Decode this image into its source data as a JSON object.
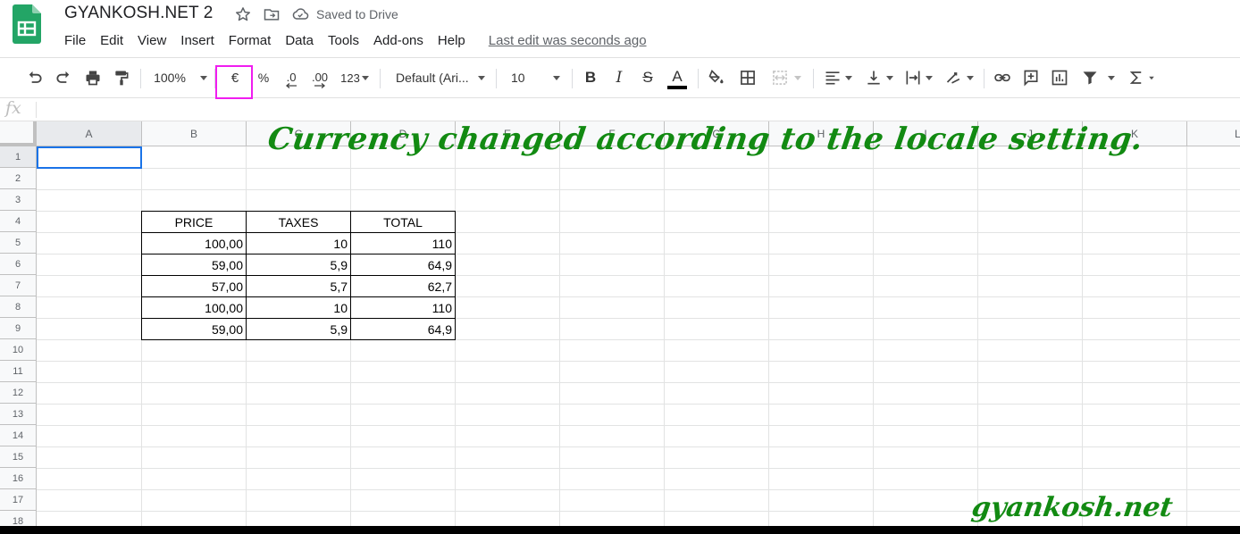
{
  "header": {
    "doc_title": "GYANKOSH.NET 2",
    "saved_status": "Saved to Drive",
    "menu": [
      "File",
      "Edit",
      "View",
      "Insert",
      "Format",
      "Data",
      "Tools",
      "Add-ons",
      "Help"
    ],
    "last_edit": "Last edit was seconds ago"
  },
  "toolbar": {
    "zoom": "100%",
    "currency_symbol": "€",
    "percent": "%",
    "decrease_decimal": ".0",
    "increase_decimal": ".00",
    "more_formats": "123",
    "font": "Default (Ari...",
    "font_size": "10",
    "bold": "B",
    "italic": "I",
    "strikethrough": "S",
    "text_color_letter": "A",
    "highlight_color": "#f01df0"
  },
  "formula_bar": {
    "fx_label": "fx"
  },
  "sheet": {
    "columns": [
      "A",
      "B",
      "C",
      "D",
      "E",
      "F",
      "G",
      "H",
      "I",
      "J",
      "K",
      "L"
    ],
    "rows": [
      "1",
      "2",
      "3",
      "4",
      "5",
      "6",
      "7",
      "8",
      "9",
      "10",
      "11",
      "12",
      "13",
      "14",
      "15",
      "16",
      "17",
      "18"
    ],
    "selected_cell": "A1",
    "table": {
      "headers": [
        "PRICE",
        "TAXES",
        "TOTAL"
      ],
      "rows": [
        [
          "100,00",
          "10",
          "110"
        ],
        [
          "59,00",
          "5,9",
          "64,9"
        ],
        [
          "57,00",
          "5,7",
          "62,7"
        ],
        [
          "100,00",
          "10",
          "110"
        ],
        [
          "59,00",
          "5,9",
          "64,9"
        ]
      ]
    }
  },
  "annotation": "Currency changed according to the locale setting.",
  "watermark": "gyankosh.net",
  "colors": {
    "annotation_green": "#128a12",
    "selection_blue": "#1a73e8",
    "sheets_green": "#23a566"
  }
}
